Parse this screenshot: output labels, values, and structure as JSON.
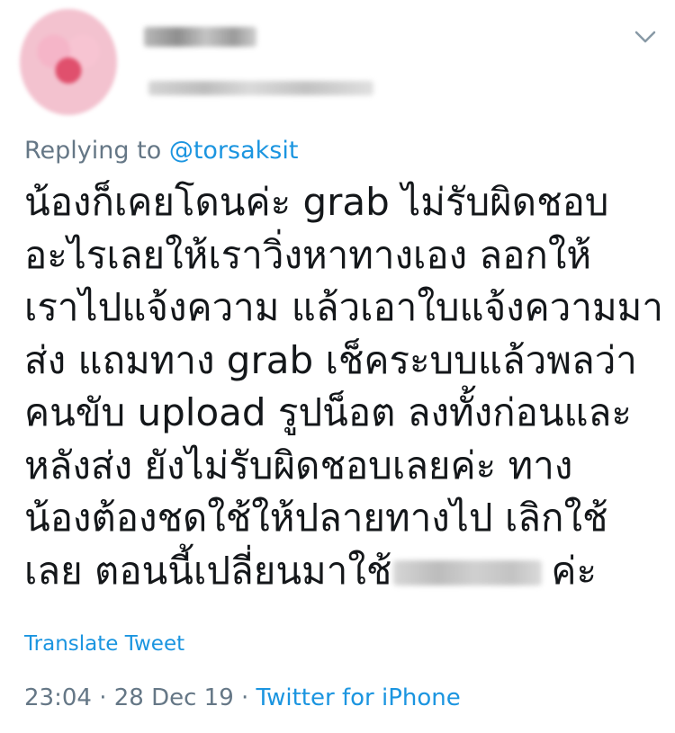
{
  "reply": {
    "prefix": "Replying to",
    "mention": "@torsaksit"
  },
  "tweet": {
    "lines": [
      "น้องก็เคยโดนค่ะ grab ไม่รับผิดชอบ",
      "อะไรเลยให้เราวิ่งหาทางเอง ลอกให้",
      "เราไปแจ้งความ แล้วเอาใบแจ้งความมา",
      "ส่ง แถมทาง grab เช็คระบบแล้วพลว่า",
      "คนขับ upload รูปน็อต ลงทั้งก่อนและ",
      "หลังส่ง ยังไม่รับผิดชอบเลยค่ะ ทาง",
      "น้องต้องชดใช้ให้ปลายทางไป เลิกใช้",
      "เลย ตอนนี้เปลี่ยนมาใช้"
    ],
    "last_suffix": "ค่ะ"
  },
  "actions": {
    "translate": "Translate Tweet"
  },
  "meta": {
    "time": "23:04",
    "separator1": " · ",
    "date": "28 Dec 19",
    "separator2": " · ",
    "source": "Twitter for iPhone"
  },
  "icons": {
    "avatar": "avatar-blurred",
    "menu": "chevron-down-icon"
  },
  "colors": {
    "text": "#14171a",
    "secondary": "#657786",
    "link": "#1b95e0"
  }
}
